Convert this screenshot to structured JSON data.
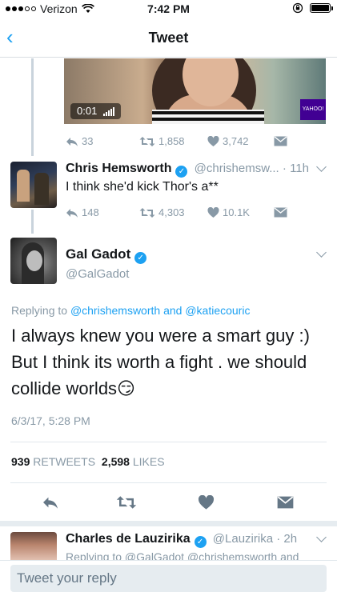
{
  "status_bar": {
    "carrier": "Verizon",
    "time": "7:42 PM"
  },
  "nav": {
    "title": "Tweet"
  },
  "prev_tweet": {
    "video_time": "0:01",
    "video_brand": "YAHOO!",
    "replies": "33",
    "retweets": "1,858",
    "likes": "3,742"
  },
  "chris_tweet": {
    "name": "Chris Hemsworth",
    "handle": "@chrishemsw...",
    "time": "· 11h",
    "text": "I think she'd kick Thor's a**",
    "replies": "148",
    "retweets": "4,303",
    "likes": "10.1K"
  },
  "main_tweet": {
    "name": "Gal Gadot",
    "handle": "@GalGadot",
    "replying_prefix": "Replying to",
    "replying_user1": "@chrishemsworth",
    "replying_and": "and",
    "replying_user2": "@katiecouric",
    "text": "I always knew you were a smart guy :) But I think its worth a fight . we should collide worlds😏",
    "timestamp": "6/3/17, 5:28 PM",
    "retweet_count": "939",
    "retweet_label": "RETWEETS",
    "like_count": "2,598",
    "like_label": "LIKES"
  },
  "next_tweet": {
    "name": "Charles de Lauzirika",
    "handle": "@Lauzirika",
    "time": "· 2h",
    "text_partial": "Replying to @GalGadot @chrishemsworth and"
  },
  "reply_box": {
    "placeholder": "Tweet your reply"
  },
  "colors": {
    "accent": "#1da1f2",
    "muted": "#8899a6",
    "like": "#e0245e"
  }
}
